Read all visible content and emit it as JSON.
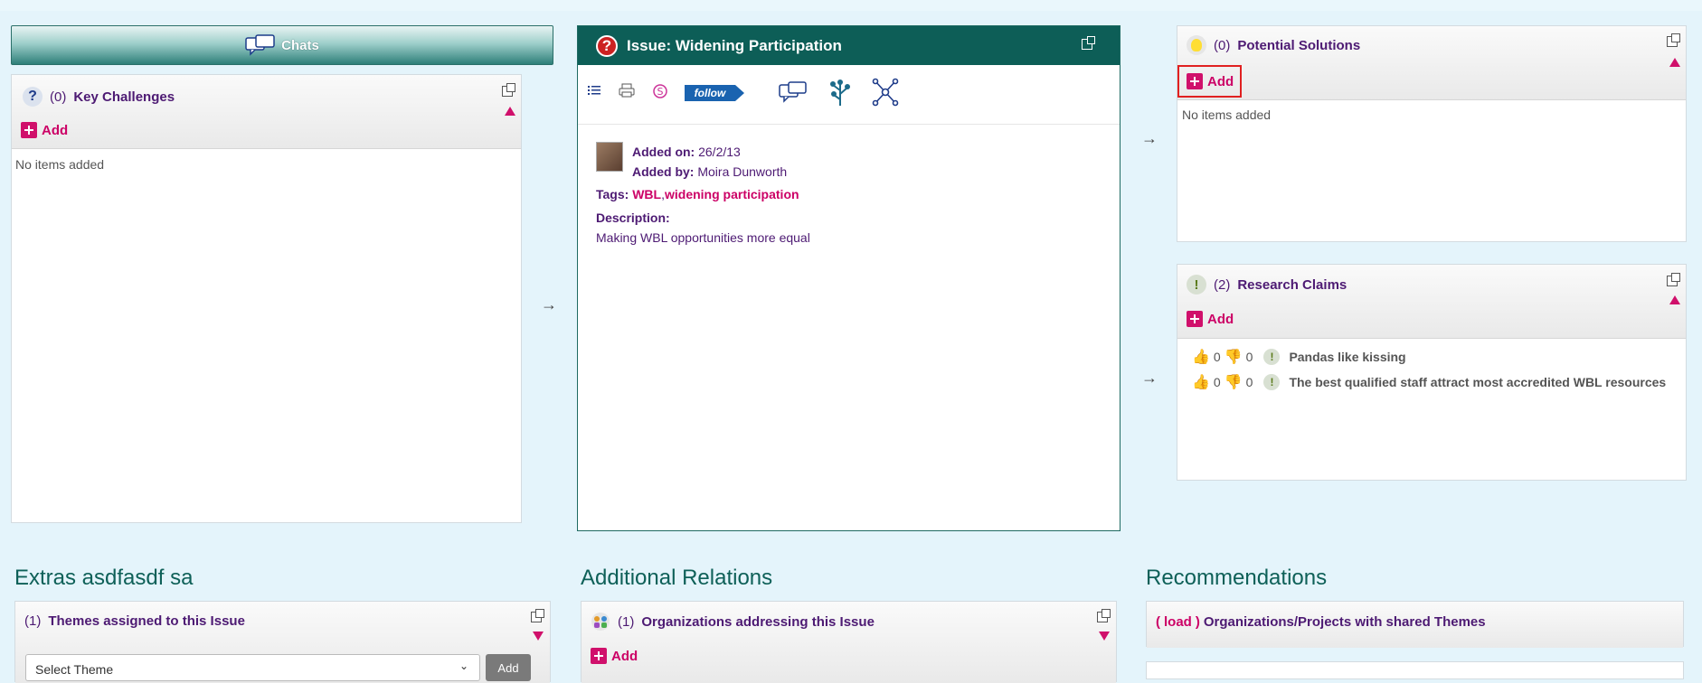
{
  "chats": {
    "label": "Chats"
  },
  "key_challenges": {
    "count": "(0)",
    "title": "Key Challenges",
    "add_label": "Add",
    "empty": "No items added"
  },
  "issue": {
    "title": "Issue: Widening Participation",
    "follow_label": "follow",
    "added_on_label": "Added on:",
    "added_on": "26/2/13",
    "added_by_label": "Added by:",
    "added_by": "Moira Dunworth",
    "tags_label": "Tags:",
    "tags": [
      "WBL",
      "widening participation"
    ],
    "tag_separator": ",",
    "description_label": "Description:",
    "description": "Making WBL opportunities more equal"
  },
  "potential_solutions": {
    "count": "(0)",
    "title": "Potential Solutions",
    "add_label": "Add",
    "empty": "No items added"
  },
  "research_claims": {
    "count": "(2)",
    "title": "Research Claims",
    "add_label": "Add",
    "items": [
      {
        "up": "0",
        "down": "0",
        "text": "Pandas like kissing"
      },
      {
        "up": "0",
        "down": "0",
        "text": "The best qualified staff attract most accredited WBL resources"
      }
    ]
  },
  "extras": {
    "section_title": "Extras asdfasdf sa",
    "themes_count": "(1)",
    "themes_title": "Themes assigned to this Issue",
    "select_value": "Select Theme",
    "select_add": "Add"
  },
  "additional_relations": {
    "section_title": "Additional Relations",
    "count": "(1)",
    "title": "Organizations addressing this Issue",
    "add_label": "Add"
  },
  "recommendations": {
    "section_title": "Recommendations",
    "paren_open": "(",
    "load_label": "load",
    "paren_close": ")",
    "text": "Organizations/Projects with shared Themes"
  },
  "colors": {
    "teal": "#0d5e57",
    "pink": "#d0106b",
    "purple": "#4d1a73",
    "background": "#e4f4fb"
  }
}
